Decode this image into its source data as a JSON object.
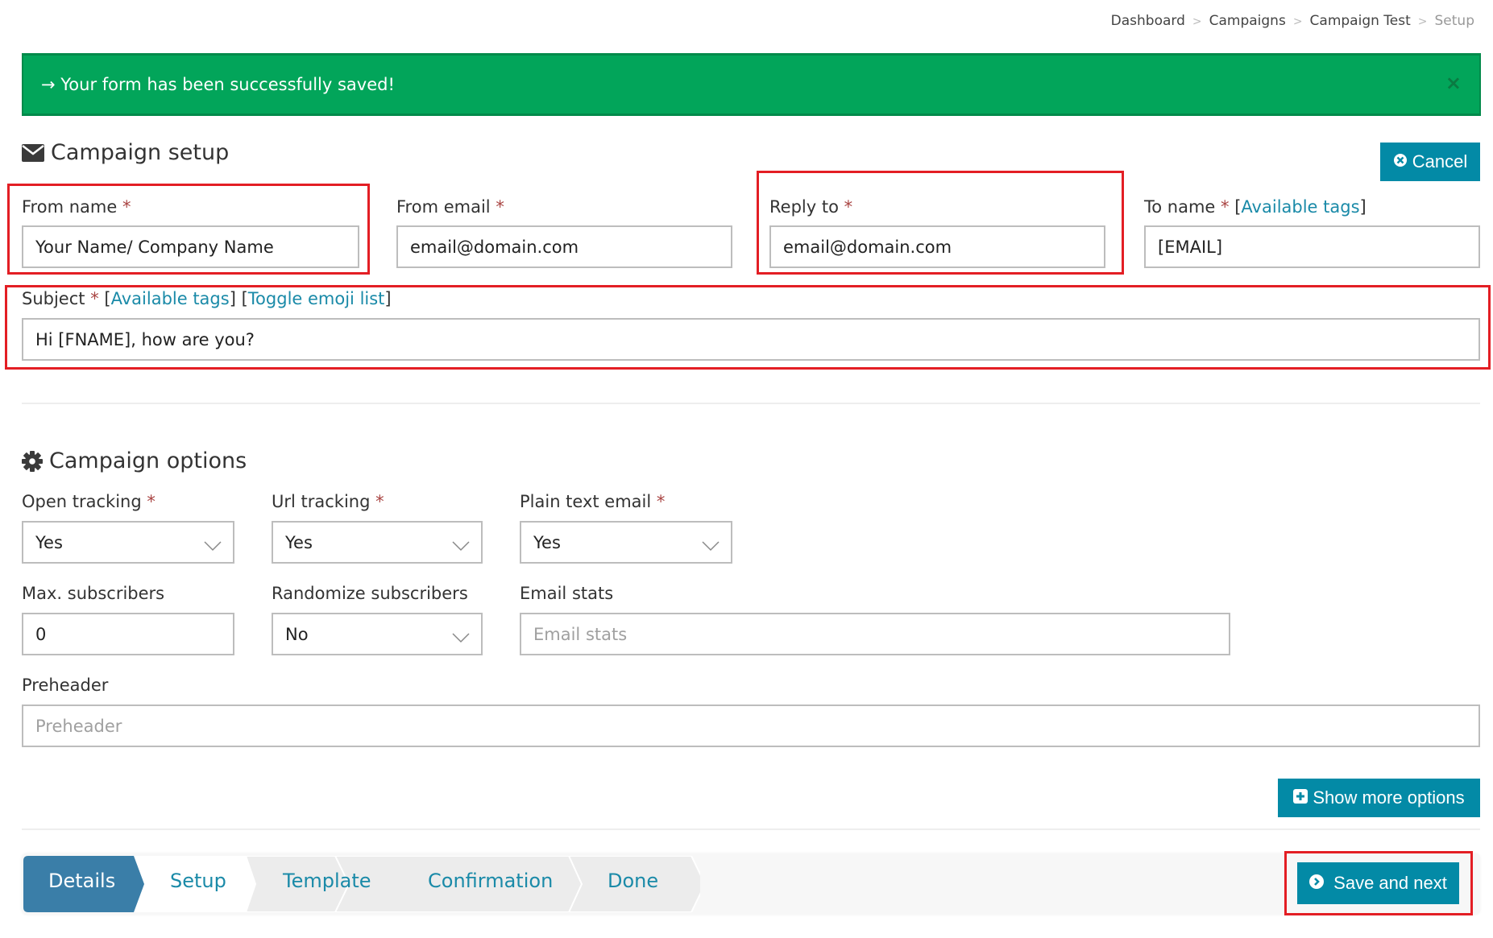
{
  "breadcrumb": [
    {
      "label": "Dashboard",
      "current": false
    },
    {
      "label": "Campaigns",
      "current": false
    },
    {
      "label": "Campaign Test",
      "current": false
    },
    {
      "label": "Setup",
      "current": true
    }
  ],
  "breadcrumb_separator": ">",
  "alert": {
    "message": "→ Your form has been successfully saved!",
    "close_icon": "×",
    "color": "#02a55a"
  },
  "campaign_setup": {
    "title": "Campaign setup",
    "icon": "envelope-icon",
    "cancel_label": "Cancel",
    "fields": {
      "from_name": {
        "label": "From name",
        "required": "*",
        "value": "Your Name/ Company Name"
      },
      "from_email": {
        "label": "From email",
        "required": "*",
        "value": "email@domain.com"
      },
      "reply_to": {
        "label": "Reply to",
        "required": "*",
        "value": "email@domain.com"
      },
      "to_name": {
        "label": "To name",
        "required": "*",
        "tags_link": "Available tags",
        "value": "[EMAIL]"
      },
      "subject": {
        "label": "Subject",
        "required": "*",
        "tags_link": "Available tags",
        "emoji_link": "Toggle emoji list",
        "value": "Hi [FNAME], how are you?"
      }
    }
  },
  "campaign_options": {
    "title": "Campaign options",
    "icon": "gear-icon",
    "fields": {
      "open_tracking": {
        "label": "Open tracking",
        "required": "*",
        "value": "Yes"
      },
      "url_tracking": {
        "label": "Url tracking",
        "required": "*",
        "value": "Yes"
      },
      "plain_text_email": {
        "label": "Plain text email",
        "required": "*",
        "value": "Yes"
      },
      "max_subscribers": {
        "label": "Max. subscribers",
        "value": "0"
      },
      "randomize_subscribers": {
        "label": "Randomize subscribers",
        "value": "No"
      },
      "email_stats": {
        "label": "Email stats",
        "value": "",
        "placeholder": "Email stats"
      },
      "preheader": {
        "label": "Preheader",
        "value": "",
        "placeholder": "Preheader"
      }
    },
    "show_more_label": "Show more options"
  },
  "wizard": {
    "steps": [
      {
        "label": "Details",
        "state": "active"
      },
      {
        "label": "Setup",
        "state": "current"
      },
      {
        "label": "Template",
        "state": "pending"
      },
      {
        "label": "Confirmation",
        "state": "pending"
      },
      {
        "label": "Done",
        "state": "pending"
      }
    ],
    "save_next_label": "Save and next"
  },
  "colors": {
    "primary": "#038aa6",
    "step_active": "#3a7ea8",
    "link": "#1a8aa8",
    "required": "#a94442",
    "highlight": "#e31e24"
  }
}
